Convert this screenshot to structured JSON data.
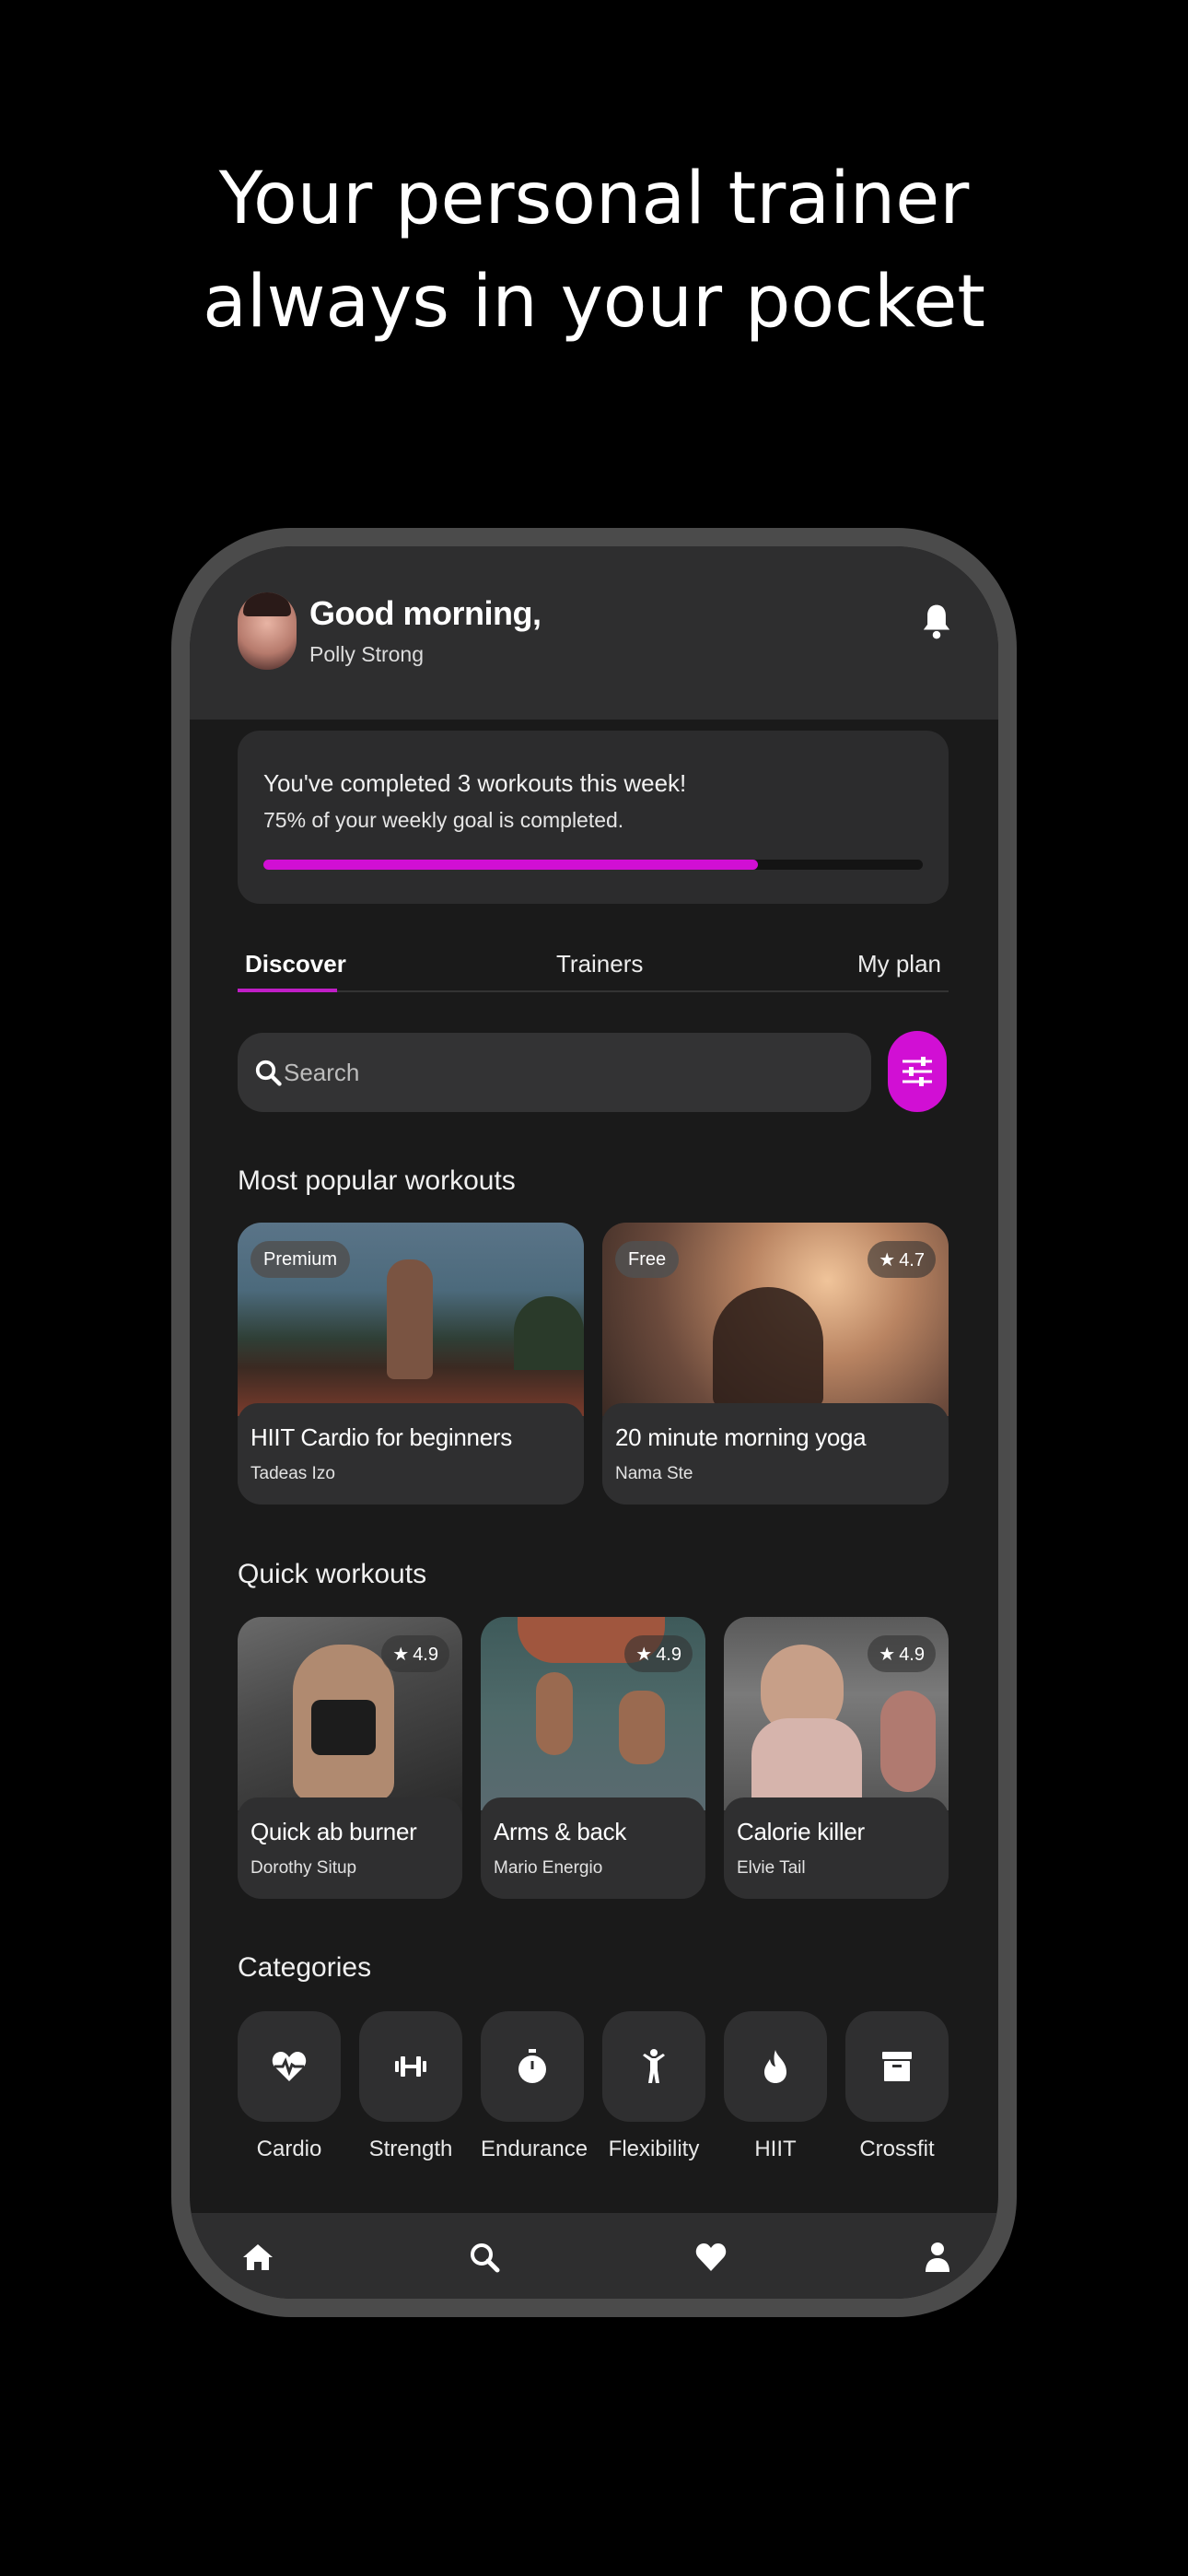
{
  "headline": {
    "line1": "Your personal trainer",
    "line2": "always in your pocket"
  },
  "header": {
    "greeting": "Good morning,",
    "user_name": "Polly Strong",
    "bell_icon": "bell-icon"
  },
  "progress": {
    "line1": "You've completed 3 workouts this week!",
    "line2": "75% of your weekly goal is completed.",
    "fraction": 0.75,
    "color": "#d10fd4"
  },
  "tabs": [
    {
      "label": "Discover",
      "active": true
    },
    {
      "label": "Trainers",
      "active": false
    },
    {
      "label": "My plan",
      "active": false
    }
  ],
  "search": {
    "placeholder": "Search"
  },
  "popular": {
    "title": "Most popular workouts",
    "cards": [
      {
        "badge": "Premium",
        "title": "HIIT Cardio for beginners",
        "trainer": "Tadeas Izo"
      },
      {
        "badge": "Free",
        "rating": "4.7",
        "title": "20 minute morning yoga",
        "trainer": "Nama Ste"
      }
    ]
  },
  "quick": {
    "title": "Quick workouts",
    "cards": [
      {
        "rating": "4.9",
        "title": "Quick ab burner",
        "trainer": "Dorothy Situp"
      },
      {
        "rating": "4.9",
        "title": "Arms & back",
        "trainer": "Mario Energio"
      },
      {
        "rating": "4.9",
        "title": "Calorie killer",
        "trainer": "Elvie Tail"
      }
    ]
  },
  "categories": {
    "title": "Categories",
    "items": [
      {
        "label": "Cardio",
        "icon": "heart-pulse-icon"
      },
      {
        "label": "Strength",
        "icon": "dumbbell-icon"
      },
      {
        "label": "Endurance",
        "icon": "stopwatch-icon"
      },
      {
        "label": "Flexibility",
        "icon": "stretch-person-icon"
      },
      {
        "label": "HIIT",
        "icon": "flame-icon"
      },
      {
        "label": "Crossfit",
        "icon": "box-icon"
      }
    ]
  },
  "nav": [
    "home-icon",
    "search-icon",
    "heart-icon",
    "user-icon"
  ]
}
